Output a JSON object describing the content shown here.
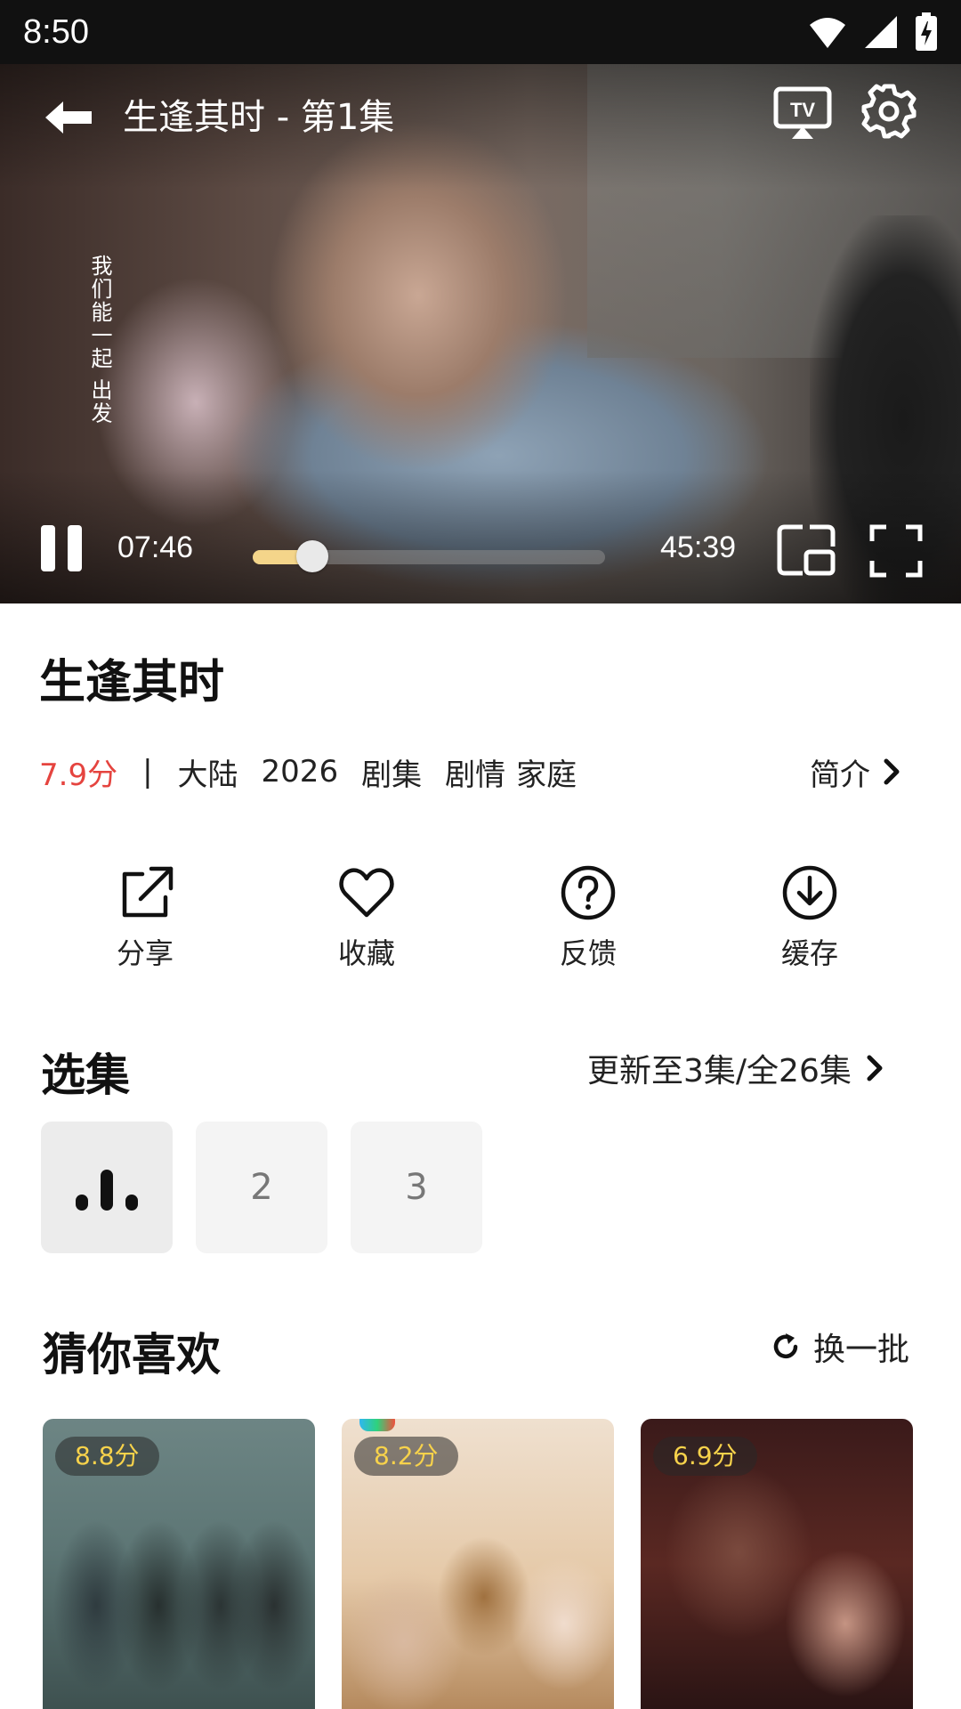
{
  "status_bar": {
    "time": "8:50"
  },
  "player": {
    "title": "生逢其时 - 第1集",
    "subtitle": "我们能一起 出发",
    "current_time": "07:46",
    "duration": "45:39",
    "progress": 0.17
  },
  "show": {
    "title": "生逢其时",
    "score": "7.9分",
    "separator": "|",
    "region": "大陆",
    "year": "2026",
    "type": "剧集",
    "genres": [
      "剧情",
      "家庭"
    ],
    "intro_label": "简介"
  },
  "actions": [
    {
      "label": "分享",
      "icon": "share-icon"
    },
    {
      "label": "收藏",
      "icon": "heart-icon"
    },
    {
      "label": "反馈",
      "icon": "question-icon"
    },
    {
      "label": "缓存",
      "icon": "download-icon"
    }
  ],
  "episodes": {
    "title": "选集",
    "update_text": "更新至3集/全26集",
    "items": [
      "1",
      "2",
      "3"
    ],
    "active_index": 0
  },
  "recommend": {
    "title": "猜你喜欢",
    "refresh_label": "换一批",
    "items": [
      {
        "score": "8.8分"
      },
      {
        "score": "8.2分"
      },
      {
        "score": "6.9分"
      }
    ]
  },
  "colors": {
    "score_red": "#e5443f",
    "badge_yellow": "#f7d24b",
    "progress_fill": "#f4d58a"
  }
}
